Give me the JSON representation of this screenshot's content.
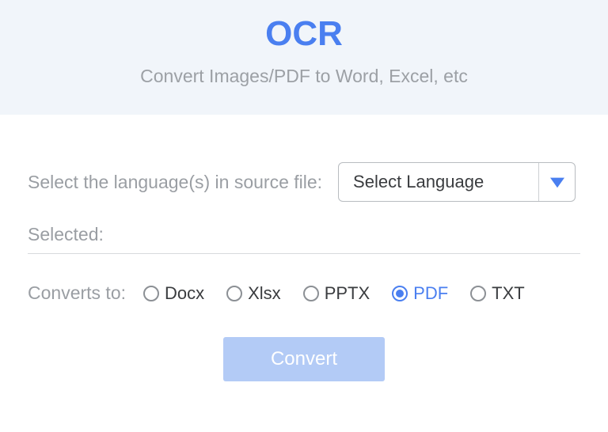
{
  "header": {
    "title": "OCR",
    "subtitle": "Convert Images/PDF to Word, Excel, etc"
  },
  "languageRow": {
    "label": "Select the language(s) in source file:",
    "selectPlaceholder": "Select Language"
  },
  "selectedRow": {
    "label": "Selected:"
  },
  "formats": {
    "label": "Converts to:",
    "options": [
      {
        "label": "Docx",
        "checked": false
      },
      {
        "label": "Xlsx",
        "checked": false
      },
      {
        "label": "PPTX",
        "checked": false
      },
      {
        "label": "PDF",
        "checked": true
      },
      {
        "label": "TXT",
        "checked": false
      }
    ]
  },
  "convertButton": {
    "label": "Convert"
  }
}
